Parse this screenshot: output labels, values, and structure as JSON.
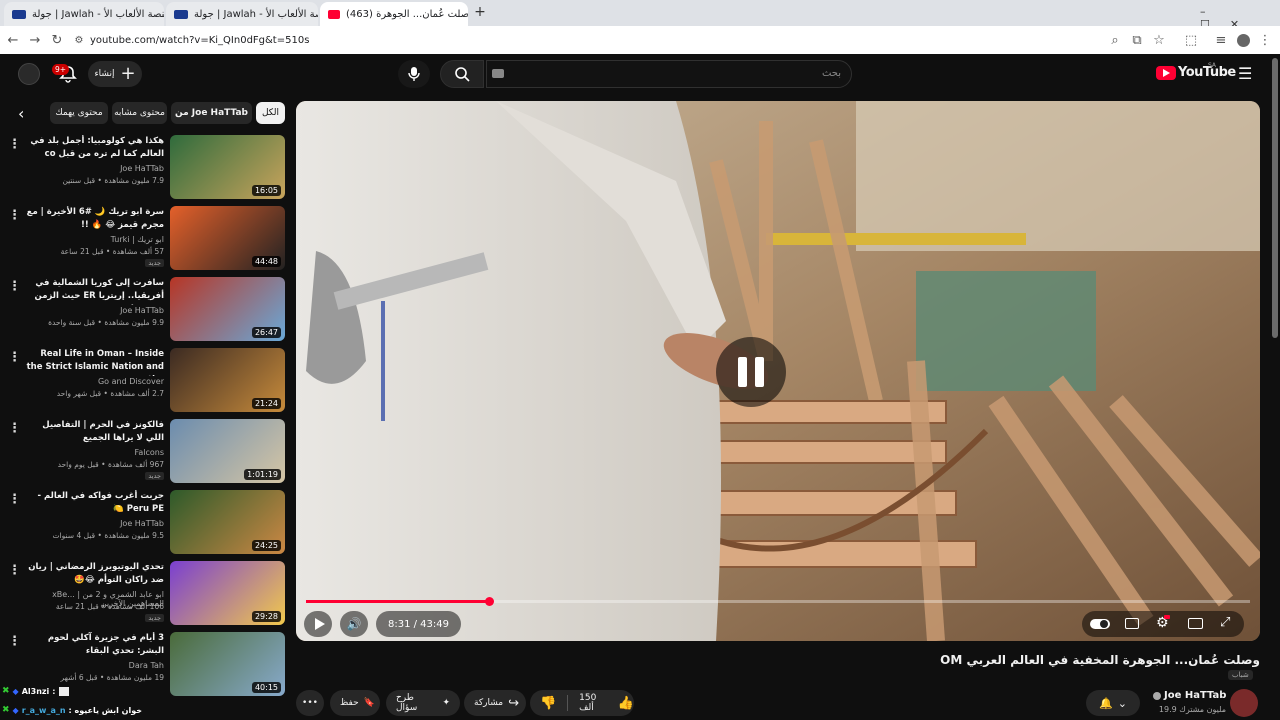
{
  "browser": {
    "tabs": [
      {
        "label": "جولة | Jawlah - منصة الألعاب الأ..."
      },
      {
        "label": "جولة | Jawlah - منصة الألعاب الأ..."
      },
      {
        "label": "(463) وصلت عُمان... الجوهرة"
      }
    ],
    "url": "youtube.com/watch?v=Ki_QIn0dFg&t=510s"
  },
  "header": {
    "logo": "YouTube",
    "region": "SA",
    "search_placeholder": "بحث",
    "create_label": "إنشاء",
    "notifications": "9+"
  },
  "chips": [
    "الكل",
    "من Joe HaTTab",
    "محتوى مشابه",
    "محتوى يهمك"
  ],
  "sidebar": {
    "videos": [
      {
        "title": "هكذا هي كولومبيا: أجمل بلد في العالم كما لم تره من قبل co",
        "channel": "Joe HaTTab",
        "meta": "7.9 مليون مشاهدة • قبل سنتين",
        "duration": "16:05",
        "new": ""
      },
      {
        "title": "سرة ابو تريك 🌙 #6 الأخيرة | مع مجرم قيمز 😂 🔥 !!",
        "channel": "Turki | ابو تريك",
        "meta": "57 ألف مشاهدة • قبل 21 ساعة",
        "duration": "44:48",
        "new": "جديد"
      },
      {
        "title": "سافرت إلى كوريا الشمالية في أفريقيا.. إريتريا ER حيث الزمن متوقف!",
        "channel": "Joe HaTTab",
        "meta": "9.9 مليون مشاهدة • قبل سنة واحدة",
        "duration": "26:47",
        "new": ""
      },
      {
        "title": "Real Life in Oman – Inside the Strict Islamic Nation and the ...",
        "channel": "Go and Discover",
        "meta": "2.7 ألف مشاهدة • قبل شهر واحد",
        "duration": "21:24",
        "new": ""
      },
      {
        "title": "فالكونز في الحرم | التفاصيل اللي لا يراها الجميع",
        "channel": "Falcons",
        "meta": "967 ألف مشاهدة • قبل يوم واحد",
        "duration": "1:01:19",
        "new": "جديد"
      },
      {
        "title": "جربت أغرب فواكه في العالم - Peru PE 🍋",
        "channel": "Joe HaTTab",
        "meta": "9.5 مليون مشاهدة • قبل 4 سنوات",
        "duration": "24:25",
        "new": ""
      },
      {
        "title": "تحدي اليوتيوبرز الرمضاني | ريان ضد راكان التوأم 😂🤩",
        "channel": "xBe... | ابو عابد الشمري و 2 من المساهمين الآخرين",
        "meta": "106 ألف مشاهدة • قبل 21 ساعة",
        "duration": "29:28",
        "new": "جديد"
      },
      {
        "title": "3 أيام في جزيرة آكلي لحوم البشر: تحدي البقاء",
        "channel": "Dara Tah",
        "meta": "19 مليون مشاهدة • قبل 6 أشهر",
        "duration": "40:15",
        "new": ""
      }
    ]
  },
  "player": {
    "current_time": "8:31",
    "duration": "43:49",
    "time_display": "8:31 / 43:49",
    "progress": 0.194
  },
  "video": {
    "title": "وصلت عُمان... الجوهرة المخفية في العالم العربي OM",
    "channel": "Joe HaTTab",
    "subscribers": "19.9 مليون مشترك",
    "badge": "شباب",
    "likes": "150 ألف",
    "share": "مشاركة",
    "ask": "طرح سؤال",
    "save": "حفظ"
  },
  "chat": [
    {
      "user": "Al3nzi",
      "text": ""
    },
    {
      "user": "r_a_w_a_n",
      "text": "خوان ابش ياعيوه :"
    }
  ],
  "colors": {
    "accent": "#ff0033",
    "bg": "#0f0f0f",
    "chip": "#272727"
  }
}
